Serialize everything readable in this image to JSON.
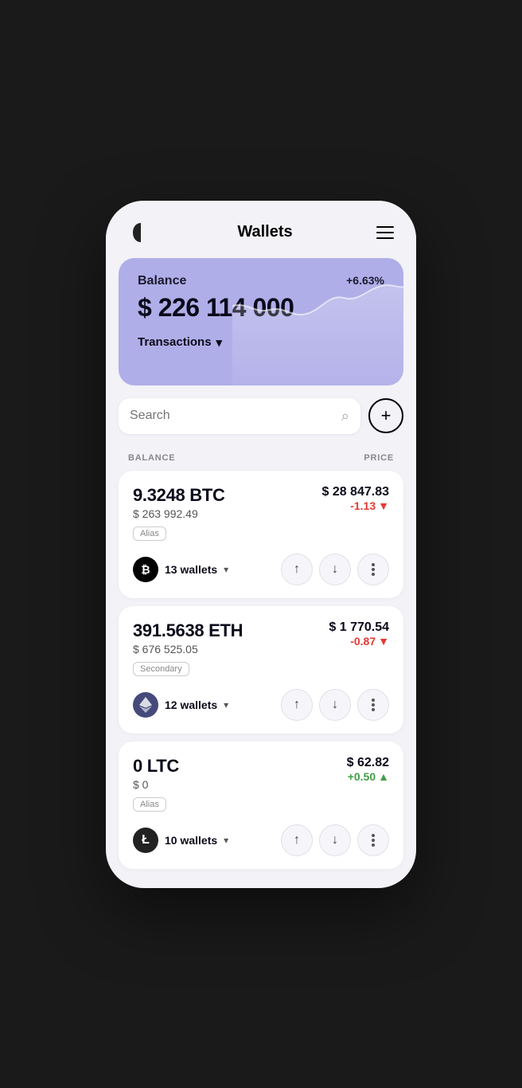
{
  "header": {
    "title": "Wallets",
    "menu_label": "Menu"
  },
  "balance_card": {
    "label": "Balance",
    "amount": "$ 226 114 000",
    "change": "+6.63%",
    "transactions_label": "Transactions"
  },
  "search": {
    "placeholder": "Search",
    "add_label": "+"
  },
  "table_headers": {
    "balance": "BALANCE",
    "price": "PRICE"
  },
  "coins": [
    {
      "id": "btc",
      "amount": "9.3248 BTC",
      "usd_value": "$ 263 992.49",
      "tag": "Alias",
      "price_usd": "$ 28 847.83",
      "price_change": "-1.13",
      "change_type": "negative",
      "wallet_count": "13 wallets",
      "logo_symbol": "₿"
    },
    {
      "id": "eth",
      "amount": "391.5638 ETH",
      "usd_value": "$ 676 525.05",
      "tag": "Secondary",
      "price_usd": "$ 1 770.54",
      "price_change": "-0.87",
      "change_type": "negative",
      "wallet_count": "12 wallets",
      "logo_symbol": "⟠"
    },
    {
      "id": "ltc",
      "amount": "0 LTC",
      "usd_value": "$ 0",
      "tag": "Alias",
      "price_usd": "$ 62.82",
      "price_change": "+0.50",
      "change_type": "positive",
      "wallet_count": "10 wallets",
      "logo_symbol": "Ł"
    }
  ],
  "icons": {
    "up_arrow": "↑",
    "down_arrow": "↓",
    "chevron_down": "▾",
    "search": "⌕",
    "more_dots": "•••"
  }
}
